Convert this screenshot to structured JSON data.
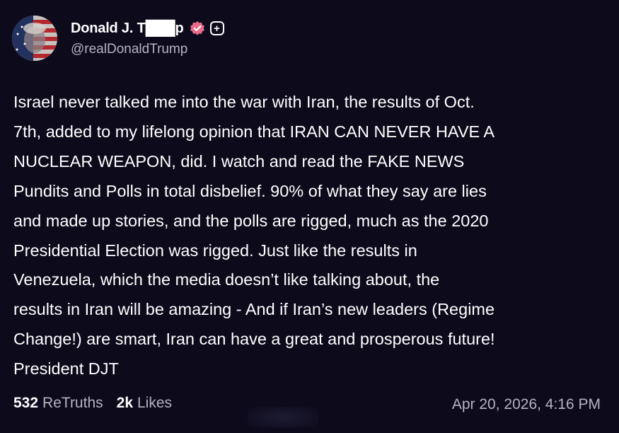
{
  "post": {
    "author": {
      "display_name": "Donald J. T███p",
      "handle": "@realDonaldTrump",
      "verified_icon": "verified-badge-icon",
      "follow_icon": "plus-icon",
      "follow_symbol": "+"
    },
    "body": "Israel never talked me into the war with Iran, the results of Oct.\n7th, added to my lifelong opinion that IRAN CAN NEVER HAVE A\nNUCLEAR WEAPON, did. I watch and read the FAKE NEWS\nPundits and Polls in total disbelief. 90% of what they say are lies\nand made up stories, and the polls are rigged, much as the 2020\nPresidential Election was rigged. Just like the results in\nVenezuela, which the media doesn’t like talking about, the\nresults in Iran will be amazing - And if Iran’s new leaders (Regime\nChange!) are smart, Iran can have a great and prosperous future!\nPresident DJT",
    "stats": {
      "retruths_count": "532",
      "retruths_label": "ReTruths",
      "likes_count": "2k",
      "likes_label": "Likes"
    },
    "timestamp": "Apr 20, 2026, 4:16 PM"
  },
  "colors": {
    "background": "#0d0a1c",
    "text": "#ffffff",
    "muted": "#b5b3c2",
    "verified": "#e86c8a"
  }
}
